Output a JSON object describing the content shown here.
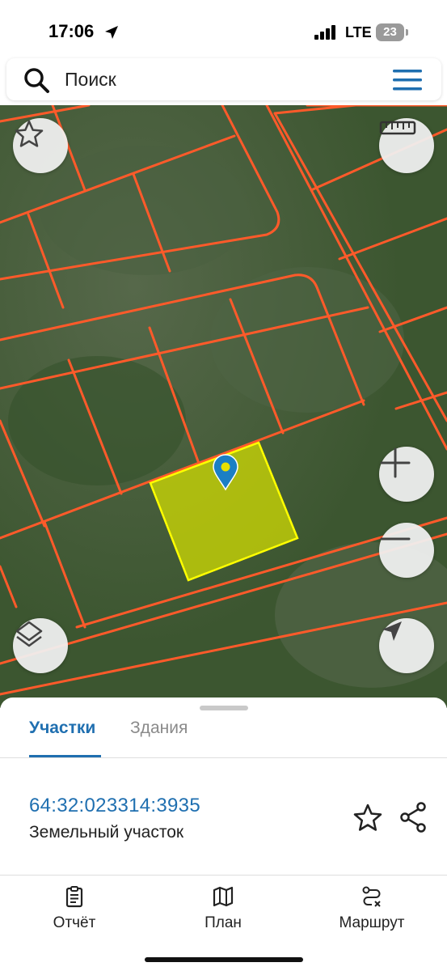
{
  "status_bar": {
    "time": "17:06",
    "network": "LTE",
    "battery": "23",
    "icons": [
      "location-arrow-icon",
      "signal-icon",
      "battery-icon"
    ]
  },
  "search": {
    "placeholder": "Поиск",
    "icons": [
      "search-icon",
      "menu-icon"
    ]
  },
  "map": {
    "parcel_highlight_color": "#d6e000",
    "boundary_color": "#ff5a2a",
    "marker_color": "#1b7fc4",
    "controls": [
      "star-icon",
      "ruler-icon",
      "plus-icon",
      "minus-icon",
      "layers-icon",
      "navigation-arrow-icon"
    ]
  },
  "sheet": {
    "tabs": [
      {
        "label": "Участки",
        "active": true
      },
      {
        "label": "Здания",
        "active": false
      }
    ],
    "parcel": {
      "number": "64:32:023314:3935",
      "type": "Земельный участок"
    }
  },
  "bottom_nav": {
    "items": [
      {
        "label": "Отчёт",
        "icon": "clipboard-icon"
      },
      {
        "label": "План",
        "icon": "map-icon"
      },
      {
        "label": "Маршрут",
        "icon": "route-icon"
      }
    ]
  },
  "colors": {
    "accent": "#1f6fb0",
    "inactive_tab": "#8a8a8a"
  }
}
